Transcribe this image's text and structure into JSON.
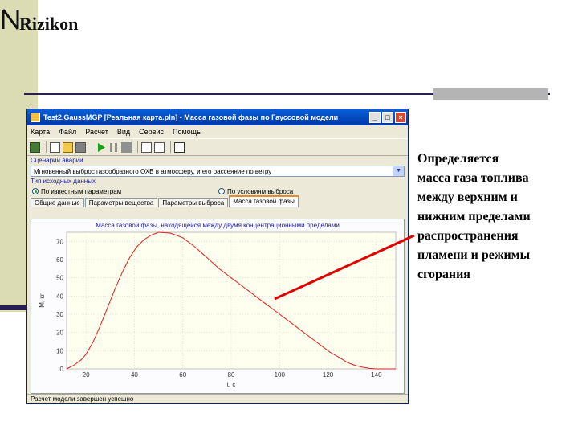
{
  "slide": {
    "logo_text": "Rizikon",
    "annotation_lines": [
      "Определяется",
      "масса газа топлива",
      "между верхним и",
      "нижним пределами",
      "распространения",
      "пламени и режимы",
      "сгорания"
    ]
  },
  "window": {
    "title": "Test2.GaussMGP [Реальная карта.pln] - Масса газовой фазы по Гауссовой модели",
    "minimize": "_",
    "maximize": "□",
    "close": "×",
    "menu": [
      "Карта",
      "Файл",
      "Расчет",
      "Вид",
      "Сервис",
      "Помощь"
    ],
    "scenario_label": "Сценарий аварии",
    "scenario_value": "Мгновенный выброс газообразного ОХВ в атмосферу, и его рассеяние по ветру",
    "source_label": "Тип исходных данных",
    "radio1": "По известным параметрам",
    "radio2": "По условиям выброса",
    "tabs": [
      "Общие данные",
      "Параметры вещества",
      "Параметры выброса",
      "Масса газовой фазы"
    ],
    "status": "Расчет модели завершен успешно"
  },
  "chart_data": {
    "type": "line",
    "title": "Масса газовой фазы, находящейся между двумя концентрационными пределами",
    "xlabel": "t, с",
    "ylabel": "M, кг",
    "xlim": [
      12,
      148
    ],
    "ylim": [
      0,
      75
    ],
    "xticks": [
      20,
      40,
      60,
      80,
      100,
      120,
      140
    ],
    "yticks": [
      0,
      10,
      20,
      30,
      40,
      50,
      60,
      70
    ],
    "grid": true,
    "series": [
      {
        "color": "#e02020",
        "x": [
          12,
          15,
          18,
          20,
          23,
          26,
          29,
          32,
          35,
          38,
          41,
          44,
          47,
          50,
          55,
          60,
          65,
          70,
          75,
          80,
          85,
          90,
          95,
          100,
          105,
          110,
          115,
          118,
          121,
          125,
          128,
          131,
          134,
          137,
          140,
          145,
          148
        ],
        "y": [
          0,
          2,
          5,
          8,
          15,
          24,
          34,
          44,
          53,
          61,
          67,
          71,
          73.5,
          75,
          74.5,
          72,
          67,
          61,
          55,
          50,
          45,
          40,
          35,
          30,
          25,
          20,
          15,
          12,
          9,
          6,
          3.5,
          2,
          1,
          0.3,
          0,
          0,
          0
        ]
      }
    ]
  }
}
